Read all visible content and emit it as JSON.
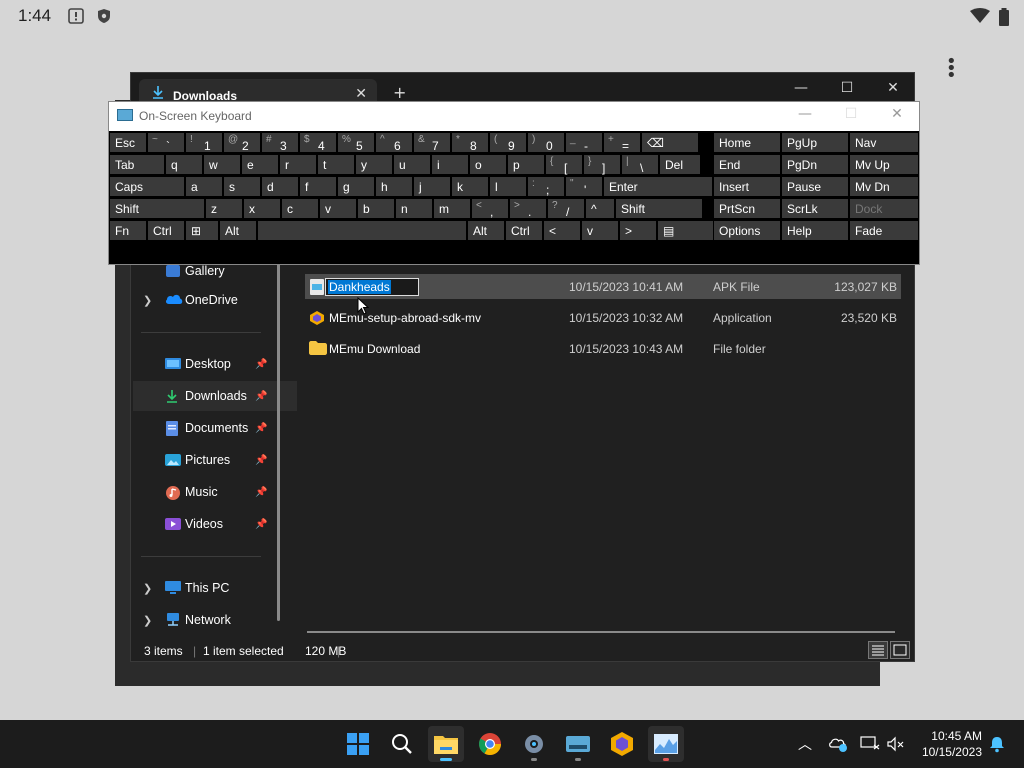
{
  "statusbar": {
    "time": "1:44"
  },
  "explorer": {
    "tab_title": "Downloads",
    "new_tab": "+",
    "controls": {
      "minimize": "—",
      "maximize": "☐",
      "close": "✕"
    }
  },
  "osk": {
    "title": "On-Screen Keyboard",
    "rows": [
      [
        {
          "s": "",
          "m": "Esc"
        },
        {
          "s": "~",
          "m": "`"
        },
        {
          "s": "!",
          "m": "1"
        },
        {
          "s": "@",
          "m": "2"
        },
        {
          "s": "#",
          "m": "3"
        },
        {
          "s": "$",
          "m": "4"
        },
        {
          "s": "%",
          "m": "5"
        },
        {
          "s": "^",
          "m": "6"
        },
        {
          "s": "&",
          "m": "7"
        },
        {
          "s": "*",
          "m": "8"
        },
        {
          "s": "(",
          "m": "9"
        },
        {
          "s": ")",
          "m": "0"
        },
        {
          "s": "_",
          "m": "-"
        },
        {
          "s": "+",
          "m": "="
        },
        {
          "s": "",
          "m": "⌫"
        }
      ],
      [
        {
          "s": "",
          "m": "Tab"
        },
        {
          "s": "",
          "m": "q"
        },
        {
          "s": "",
          "m": "w"
        },
        {
          "s": "",
          "m": "e"
        },
        {
          "s": "",
          "m": "r"
        },
        {
          "s": "",
          "m": "t"
        },
        {
          "s": "",
          "m": "y"
        },
        {
          "s": "",
          "m": "u"
        },
        {
          "s": "",
          "m": "i"
        },
        {
          "s": "",
          "m": "o"
        },
        {
          "s": "",
          "m": "p"
        },
        {
          "s": "{",
          "m": "["
        },
        {
          "s": "}",
          "m": "]"
        },
        {
          "s": "|",
          "m": "\\"
        },
        {
          "s": "",
          "m": "Del"
        }
      ],
      [
        {
          "s": "",
          "m": "Caps"
        },
        {
          "s": "",
          "m": "a"
        },
        {
          "s": "",
          "m": "s"
        },
        {
          "s": "",
          "m": "d"
        },
        {
          "s": "",
          "m": "f"
        },
        {
          "s": "",
          "m": "g"
        },
        {
          "s": "",
          "m": "h"
        },
        {
          "s": "",
          "m": "j"
        },
        {
          "s": "",
          "m": "k"
        },
        {
          "s": "",
          "m": "l"
        },
        {
          "s": ":",
          "m": ";"
        },
        {
          "s": "\"",
          "m": "'"
        },
        {
          "s": "",
          "m": "Enter"
        }
      ],
      [
        {
          "s": "",
          "m": "Shift"
        },
        {
          "s": "",
          "m": "z"
        },
        {
          "s": "",
          "m": "x"
        },
        {
          "s": "",
          "m": "c"
        },
        {
          "s": "",
          "m": "v"
        },
        {
          "s": "",
          "m": "b"
        },
        {
          "s": "",
          "m": "n"
        },
        {
          "s": "",
          "m": "m"
        },
        {
          "s": "<",
          "m": ","
        },
        {
          "s": ">",
          "m": "."
        },
        {
          "s": "?",
          "m": "/"
        },
        {
          "s": "",
          "m": "^"
        },
        {
          "s": "",
          "m": "Shift"
        }
      ],
      [
        {
          "s": "",
          "m": "Fn"
        },
        {
          "s": "",
          "m": "Ctrl"
        },
        {
          "s": "",
          "m": "⊞"
        },
        {
          "s": "",
          "m": "Alt"
        },
        {
          "s": "",
          "m": ""
        },
        {
          "s": "",
          "m": "Alt"
        },
        {
          "s": "",
          "m": "Ctrl"
        },
        {
          "s": "",
          "m": "<"
        },
        {
          "s": "",
          "m": "v"
        },
        {
          "s": "",
          "m": ">"
        },
        {
          "s": "",
          "m": "▤"
        }
      ]
    ],
    "nav_rows": [
      [
        "Home",
        "PgUp",
        "Nav"
      ],
      [
        "End",
        "PgDn",
        "Mv Up"
      ],
      [
        "Insert",
        "Pause",
        "Mv Dn"
      ],
      [
        "PrtScn",
        "ScrLk",
        "Dock"
      ],
      [
        "Options",
        "Help",
        "Fade"
      ]
    ]
  },
  "sidebar": {
    "gallery": "Gallery",
    "onedrive": "OneDrive",
    "quick": [
      {
        "label": "Desktop",
        "icon": "desktop-icon"
      },
      {
        "label": "Downloads",
        "icon": "downloads-icon"
      },
      {
        "label": "Documents",
        "icon": "documents-icon"
      },
      {
        "label": "Pictures",
        "icon": "pictures-icon"
      },
      {
        "label": "Music",
        "icon": "music-icon"
      },
      {
        "label": "Videos",
        "icon": "videos-icon"
      }
    ],
    "this_pc": "This PC",
    "network": "Network"
  },
  "files": [
    {
      "name": "Dankheads",
      "date": "10/15/2023 10:41 AM",
      "type": "APK File",
      "size": "123,027 KB",
      "icon": "apk-file-icon",
      "renaming": true
    },
    {
      "name": "MEmu-setup-abroad-sdk-mv",
      "date": "10/15/2023 10:32 AM",
      "type": "Application",
      "size": "23,520 KB",
      "icon": "memu-app-icon",
      "renaming": false
    },
    {
      "name": "MEmu Download",
      "date": "10/15/2023 10:43 AM",
      "type": "File folder",
      "size": "",
      "icon": "folder-icon",
      "renaming": false
    }
  ],
  "status": {
    "count": "3 items",
    "selection": "1 item selected",
    "size": "120 MB"
  },
  "taskbar": {
    "time": "10:45 AM",
    "date": "10/15/2023"
  }
}
